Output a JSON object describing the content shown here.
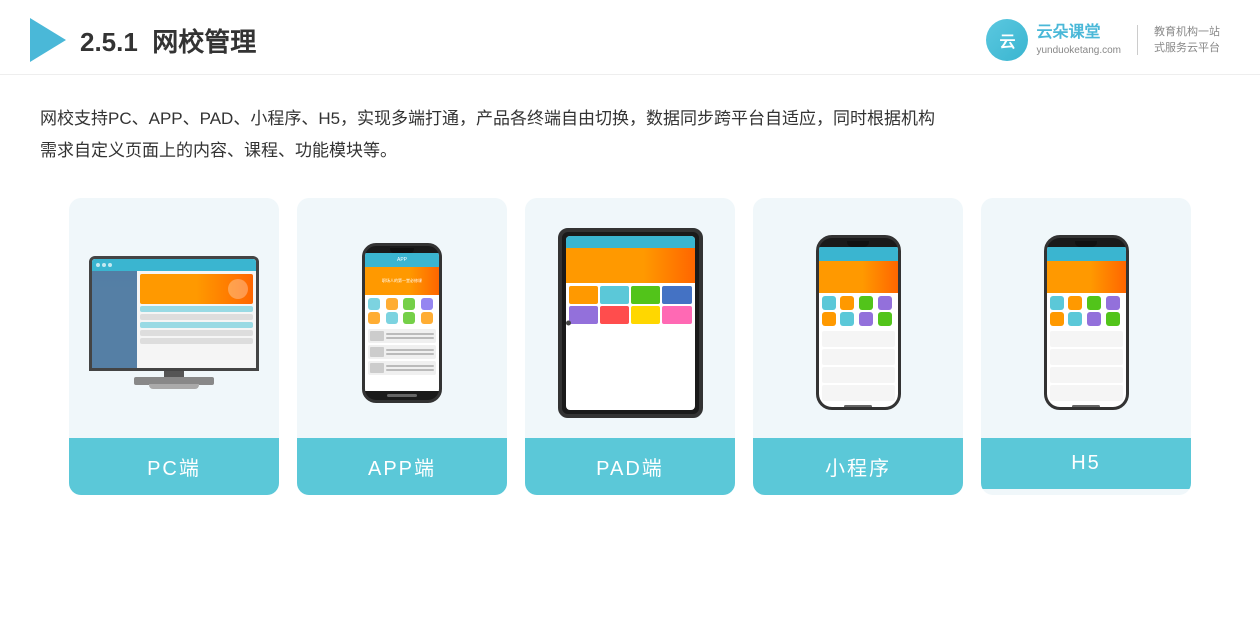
{
  "header": {
    "section": "2.5.1",
    "title": "网校管理",
    "brand": "云朵课堂",
    "brand_url": "yunduoketang.com",
    "slogan_line1": "教育机构一站",
    "slogan_line2": "式服务云平台"
  },
  "description": {
    "line1": "网校支持PC、APP、PAD、小程序、H5，实现多端打通，产品各终端自由切换，数据同步跨平台自适应，同时根据机构",
    "line2": "需求自定义页面上的内容、课程、功能模块等。"
  },
  "cards": [
    {
      "id": "pc",
      "label": "PC端"
    },
    {
      "id": "app",
      "label": "APP端"
    },
    {
      "id": "pad",
      "label": "PAD端"
    },
    {
      "id": "miniprogram",
      "label": "小程序"
    },
    {
      "id": "h5",
      "label": "H5"
    }
  ],
  "colors": {
    "teal": "#5bc8d8",
    "brand_blue": "#4ab8d8",
    "arrow_blue": "#4ab8d8",
    "orange": "#ff9900",
    "text_dark": "#333333",
    "bg_card": "#eef7fb"
  }
}
